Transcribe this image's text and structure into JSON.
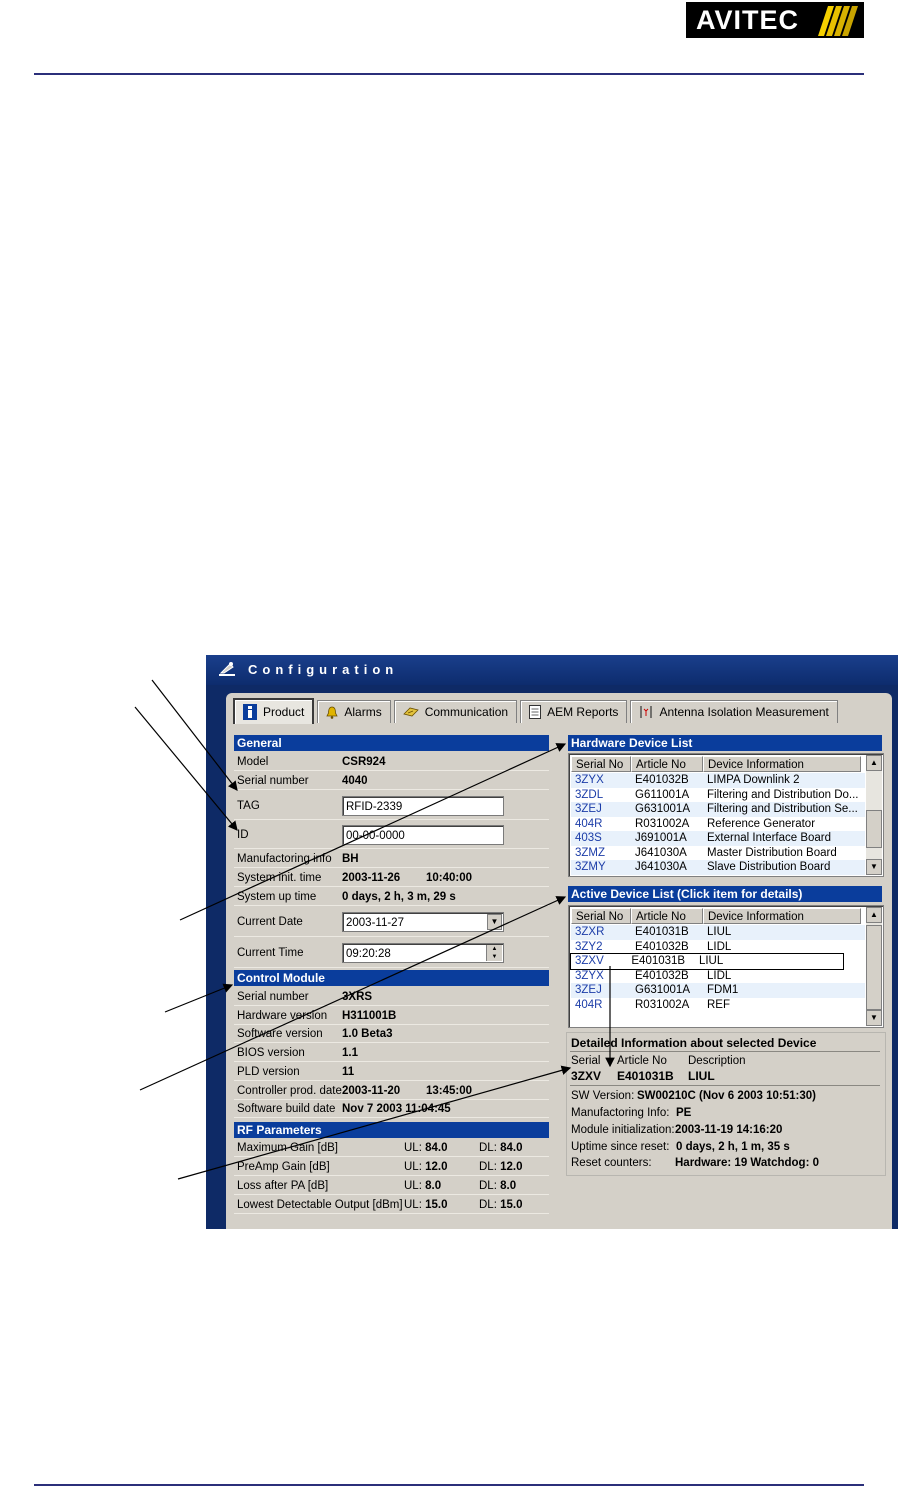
{
  "logo": {
    "text": "AVITEC"
  },
  "window": {
    "title": "Configuration"
  },
  "tabs": [
    {
      "label": "Product",
      "icon": "info-icon"
    },
    {
      "label": "Alarms",
      "icon": "bell-icon"
    },
    {
      "label": "Communication",
      "icon": "communication-icon"
    },
    {
      "label": "AEM Reports",
      "icon": "report-icon"
    },
    {
      "label": "Antenna Isolation Measurement",
      "icon": "antenna-icon"
    }
  ],
  "general": {
    "title": "General",
    "model_label": "Model",
    "model": "CSR924",
    "serial_label": "Serial number",
    "serial": "4040",
    "tag_label": "TAG",
    "tag": "RFID-2339",
    "id_label": "ID",
    "id": "00-00-0000",
    "mfg_label": "Manufactoring info",
    "mfg": "BH",
    "init_label": "System init. time",
    "init_date": "2003-11-26",
    "init_time": "10:40:00",
    "uptime_label": "System up time",
    "uptime": "0 days, 2 h, 3 m, 29 s",
    "date_label": "Current Date",
    "date": "2003-11-27",
    "time_label": "Current Time",
    "time": "09:20:28"
  },
  "control": {
    "title": "Control Module",
    "rows": [
      {
        "label": "Serial number",
        "value": "3XRS"
      },
      {
        "label": "Hardware version",
        "value": "H311001B"
      },
      {
        "label": "Software version",
        "value": "1.0 Beta3"
      },
      {
        "label": "BIOS version",
        "value": "1.1"
      },
      {
        "label": "PLD version",
        "value": "11"
      },
      {
        "label": "Controller prod. date",
        "value": "2003-11-20",
        "value2": "13:45:00"
      },
      {
        "label": "Software build date",
        "value": "Nov  7 2003 11:04:45"
      }
    ]
  },
  "rf": {
    "title": "RF Parameters",
    "ul_prefix": "UL:",
    "dl_prefix": "DL:",
    "rows": [
      {
        "label": "Maximum Gain [dB]",
        "ul": "84.0",
        "dl": "84.0"
      },
      {
        "label": "PreAmp Gain [dB]",
        "ul": "12.0",
        "dl": "12.0"
      },
      {
        "label": "Loss after PA [dB]",
        "ul": "8.0",
        "dl": "8.0"
      },
      {
        "label": "Lowest Detectable Output [dBm]",
        "ul": "15.0",
        "dl": "15.0"
      }
    ]
  },
  "hardware_list": {
    "title": "Hardware Device List",
    "headers": [
      "Serial No",
      "Article No",
      "Device Information"
    ],
    "rows": [
      [
        "3ZYX",
        "E401032B",
        "LIMPA Downlink 2"
      ],
      [
        "3ZDL",
        "G611001A",
        "Filtering and Distribution Do..."
      ],
      [
        "3ZEJ",
        "G631001A",
        "Filtering and Distribution Se..."
      ],
      [
        "404R",
        "R031002A",
        "Reference Generator"
      ],
      [
        "403S",
        "J691001A",
        "External Interface Board"
      ],
      [
        "3ZMZ",
        "J641030A",
        "Master Distribution Board"
      ],
      [
        "3ZMY",
        "J641030A",
        "Slave Distribution Board"
      ]
    ]
  },
  "active_list": {
    "title": "Active Device List  (Click item for details)",
    "headers": [
      "Serial No",
      "Article No",
      "Device Information"
    ],
    "rows": [
      [
        "3ZXR",
        "E401031B",
        "LIUL"
      ],
      [
        "3ZY2",
        "E401032B",
        "LIDL"
      ],
      [
        "3ZXV",
        "E401031B",
        "LIUL"
      ],
      [
        "3ZYX",
        "E401032B",
        "LIDL"
      ],
      [
        "3ZEJ",
        "G631001A",
        "FDM1"
      ],
      [
        "404R",
        "R031002A",
        "REF"
      ]
    ],
    "selected_index": 2
  },
  "detail": {
    "title": "Detailed Information about selected Device",
    "serial_label": "Serial",
    "article_label": "Article No",
    "desc_label": "Description",
    "serial": "3ZXV",
    "article": "E401031B",
    "desc": "LIUL",
    "sw_label": "SW Version:",
    "sw": "SW00210C (Nov  6 2003  10:51:30)",
    "mfg_label": "Manufactoring Info:",
    "mfg": "PE",
    "init_label": "Module initialization:",
    "init": "2003-11-19  14:16:20",
    "uptime_label": "Uptime since reset:",
    "uptime": "0 days, 2 h, 1 m, 35 s",
    "reset_label": "Reset counters:",
    "reset": "Hardware: 19  Watchdog: 0"
  }
}
